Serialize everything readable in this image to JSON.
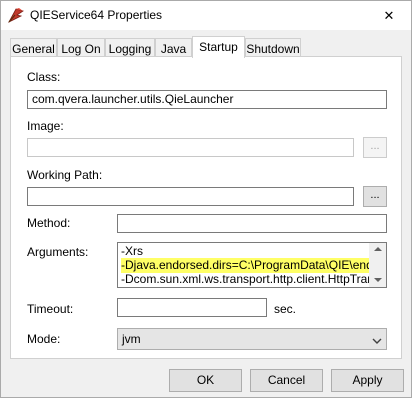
{
  "window": {
    "title": "QIEService64 Properties",
    "close_glyph": "✕"
  },
  "tabs": [
    {
      "label": "General"
    },
    {
      "label": "Log On"
    },
    {
      "label": "Logging"
    },
    {
      "label": "Java"
    },
    {
      "label": "Startup",
      "active": true
    },
    {
      "label": "Shutdown"
    }
  ],
  "form": {
    "class_label": "Class:",
    "class_value": "com.qvera.launcher.utils.QieLauncher",
    "image_label": "Image:",
    "image_value": "",
    "image_browse": "...",
    "working_path_label": "Working Path:",
    "working_path_value": "",
    "working_path_browse": "...",
    "method_label": "Method:",
    "method_value": "",
    "arguments_label": "Arguments:",
    "arguments_lines": [
      "-Xrs",
      "-Djava.endorsed.dirs=C:\\ProgramData\\QIE\\endor",
      "-Dcom.sun.xml.ws.transport.http.client.HttpTrans"
    ],
    "timeout_label": "Timeout:",
    "timeout_value": "",
    "timeout_unit": "sec.",
    "mode_label": "Mode:",
    "mode_value": "jvm"
  },
  "buttons": {
    "ok": "OK",
    "cancel": "Cancel",
    "apply": "Apply"
  },
  "colors": {
    "highlight": "#ffff66",
    "window_bg": "#f0f0f0",
    "panel_bg": "#ffffff"
  }
}
